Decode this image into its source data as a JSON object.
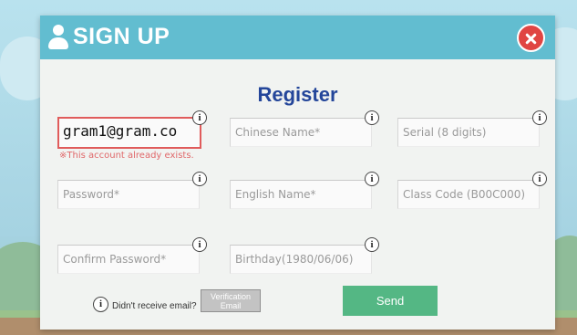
{
  "header": {
    "title": "SIGN UP",
    "icon": "user-icon",
    "close_icon": "close-icon"
  },
  "heading": "Register",
  "fields": {
    "email": {
      "value": "gram1@gram.co"
    },
    "chinese_name": {
      "placeholder": "Chinese Name*"
    },
    "serial": {
      "placeholder": "Serial (8 digits)"
    },
    "password": {
      "placeholder": "Password*"
    },
    "english_name": {
      "placeholder": "English Name*"
    },
    "class_code": {
      "placeholder": "Class Code (B00C000)"
    },
    "confirm_password": {
      "placeholder": "Confirm Password*"
    },
    "birthday": {
      "placeholder": "Birthday(1980/06/06)"
    }
  },
  "error_message": "※This account already exists.",
  "info_glyph": "i",
  "bottom": {
    "didnt_receive": "Didn't receive email?",
    "verification_line1": "Verification",
    "verification_line2": "Email",
    "send_label": "Send"
  },
  "colors": {
    "header": "#62bdd0",
    "heading": "#24469a",
    "error": "#e05b5b",
    "send": "#54b784",
    "close": "#e04543"
  }
}
